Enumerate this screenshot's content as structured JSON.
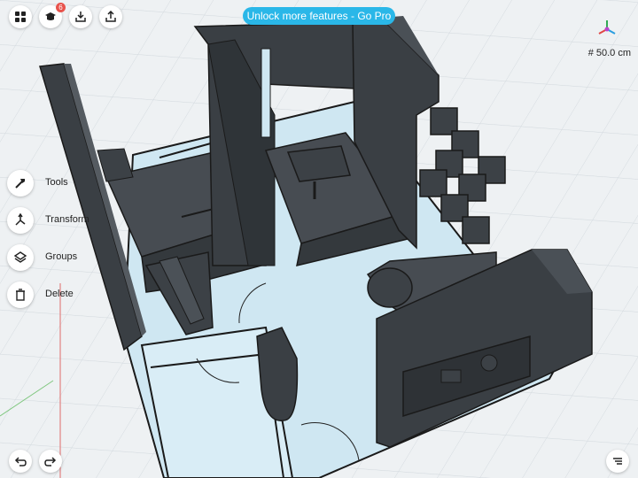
{
  "top_toolbar": {
    "items": [
      {
        "name": "grid-menu-icon"
      },
      {
        "name": "graduation-cap-icon",
        "badge": "6"
      },
      {
        "name": "download-icon"
      },
      {
        "name": "share-icon"
      }
    ]
  },
  "promo_banner": {
    "label": "Unlock more features - Go Pro"
  },
  "scale_indicator": {
    "text": "# 50.0 cm"
  },
  "side_menu": {
    "items": [
      {
        "label": "Tools",
        "icon": "hammer-icon"
      },
      {
        "label": "Transform",
        "icon": "transform-arrows-icon"
      },
      {
        "label": "Groups",
        "icon": "layers-icon"
      },
      {
        "label": "Delete",
        "icon": "trash-icon"
      }
    ]
  },
  "bottom_controls": {
    "undo_icon": "undo-icon",
    "redo_icon": "redo-icon",
    "menu_icon": "list-menu-icon"
  },
  "colors": {
    "grid_background": "#eef1f3",
    "grid_line": "#d0d6db",
    "floor": "#cfe7f2",
    "wall_dark": "#3c4146",
    "wall_top": "#4a5056",
    "accent_blue": "#2ab7e8",
    "badge_red": "#e8534c"
  }
}
